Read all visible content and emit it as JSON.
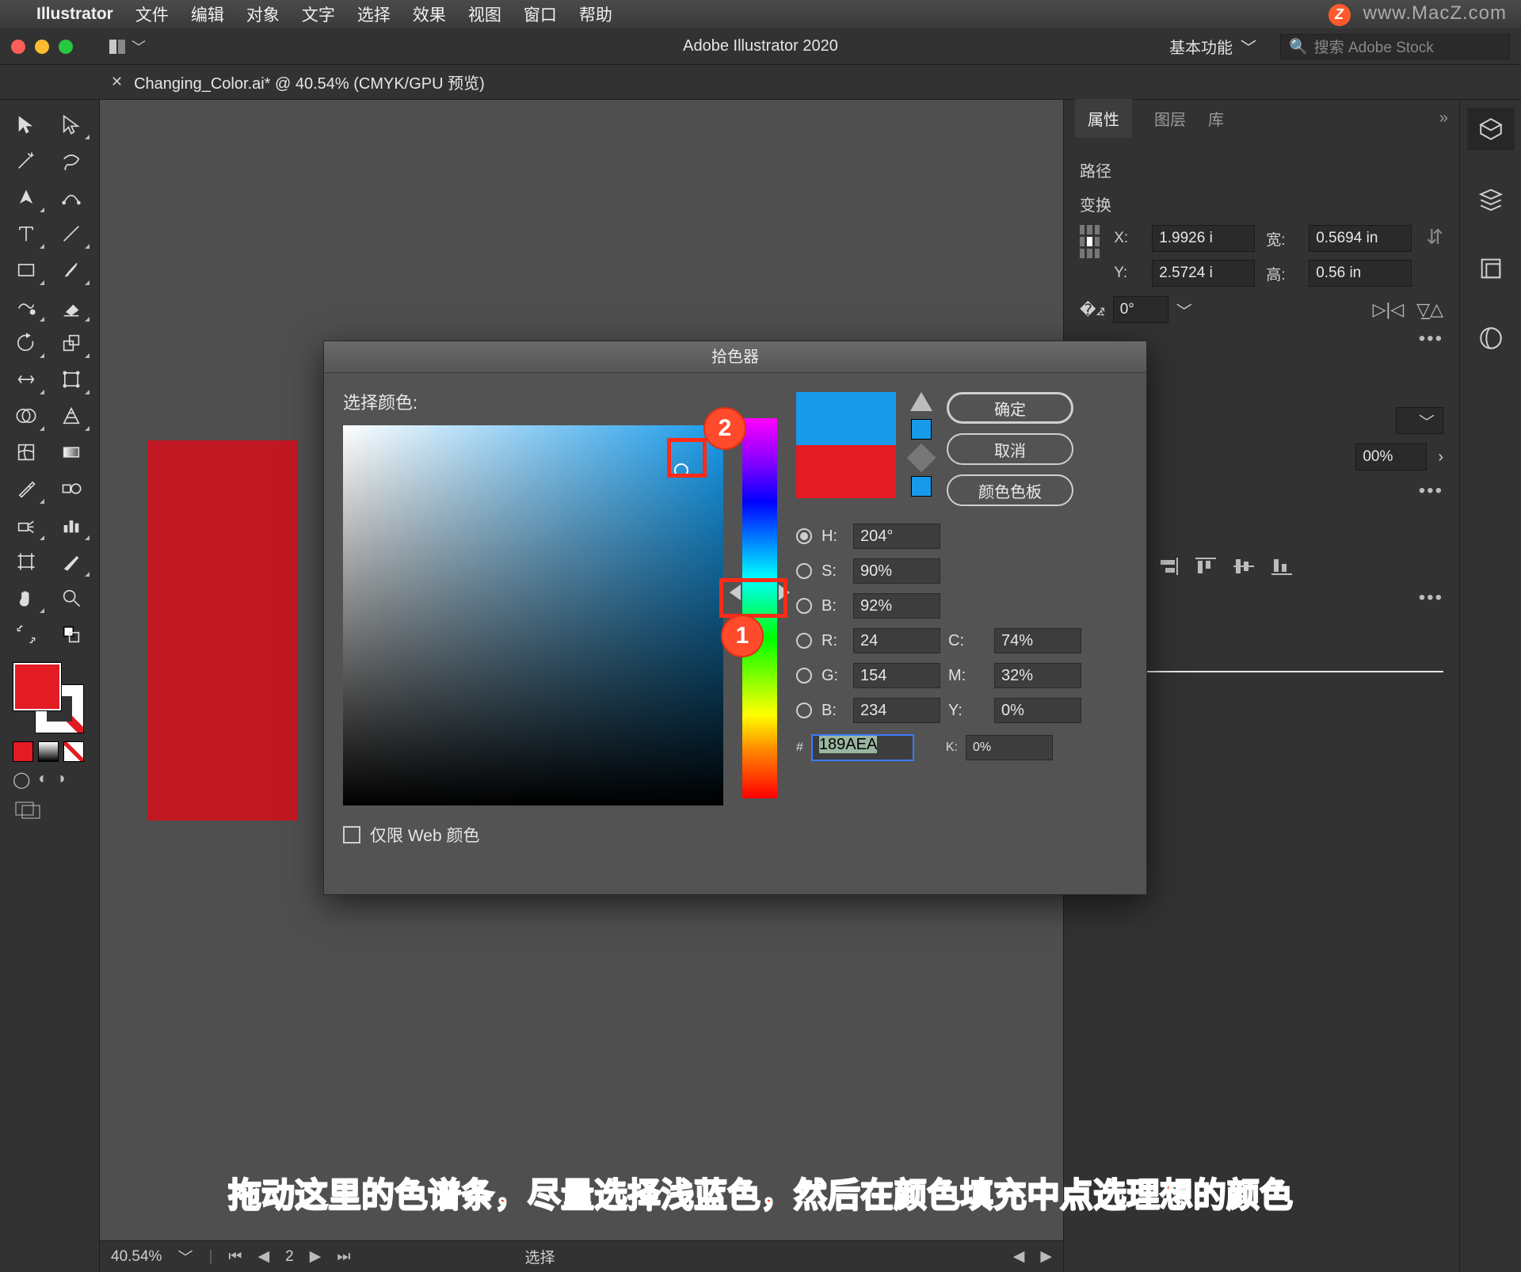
{
  "menubar": {
    "app_name": "Illustrator",
    "items": [
      "文件",
      "编辑",
      "对象",
      "文字",
      "选择",
      "效果",
      "视图",
      "窗口",
      "帮助"
    ],
    "watermark": "www.MacZ.com",
    "z": "Z"
  },
  "appbar": {
    "title": "Adobe Illustrator 2020",
    "workspace": "基本功能",
    "search_placeholder": "搜索 Adobe Stock"
  },
  "document_tab": {
    "name": "Changing_Color.ai* @ 40.54% (CMYK/GPU 预览)"
  },
  "right_panel": {
    "tabs": [
      "属性",
      "图层",
      "库"
    ],
    "active_tab": 0,
    "path_label": "路径",
    "transform_label": "变换",
    "x_label": "X:",
    "x_value": "1.9926 i",
    "y_label": "Y:",
    "y_value": "2.5724 i",
    "w_label": "宽:",
    "w_value": "0.5694 in",
    "h_label": "高:",
    "h_value": "0.56 in",
    "angle_value": "0°",
    "opacity_value": "00%"
  },
  "picker": {
    "title": "拾色器",
    "select_label": "选择颜色:",
    "ok": "确定",
    "cancel": "取消",
    "swatches": "颜色色板",
    "H_label": "H:",
    "H_value": "204°",
    "S_label": "S:",
    "S_value": "90%",
    "Br_label": "B:",
    "Br_value": "92%",
    "R_label": "R:",
    "R_value": "24",
    "G_label": "G:",
    "G_value": "154",
    "Bl_label": "B:",
    "Bl_value": "234",
    "C_label": "C:",
    "C_value": "74%",
    "M_label": "M:",
    "M_value": "32%",
    "Y_label": "Y:",
    "Y_value": "0%",
    "K_label": "K:",
    "K_value": "0%",
    "hex_prefix": "#",
    "hex_value": "189AEA",
    "web_only": "仅限 Web 颜色",
    "callout1": "1",
    "callout2": "2"
  },
  "statusbar": {
    "zoom": "40.54%",
    "page": "2",
    "tool": "选择"
  },
  "caption": "拖动这里的色谱条，尽量选择浅蓝色，然后在颜色填充中点选理想的颜色"
}
